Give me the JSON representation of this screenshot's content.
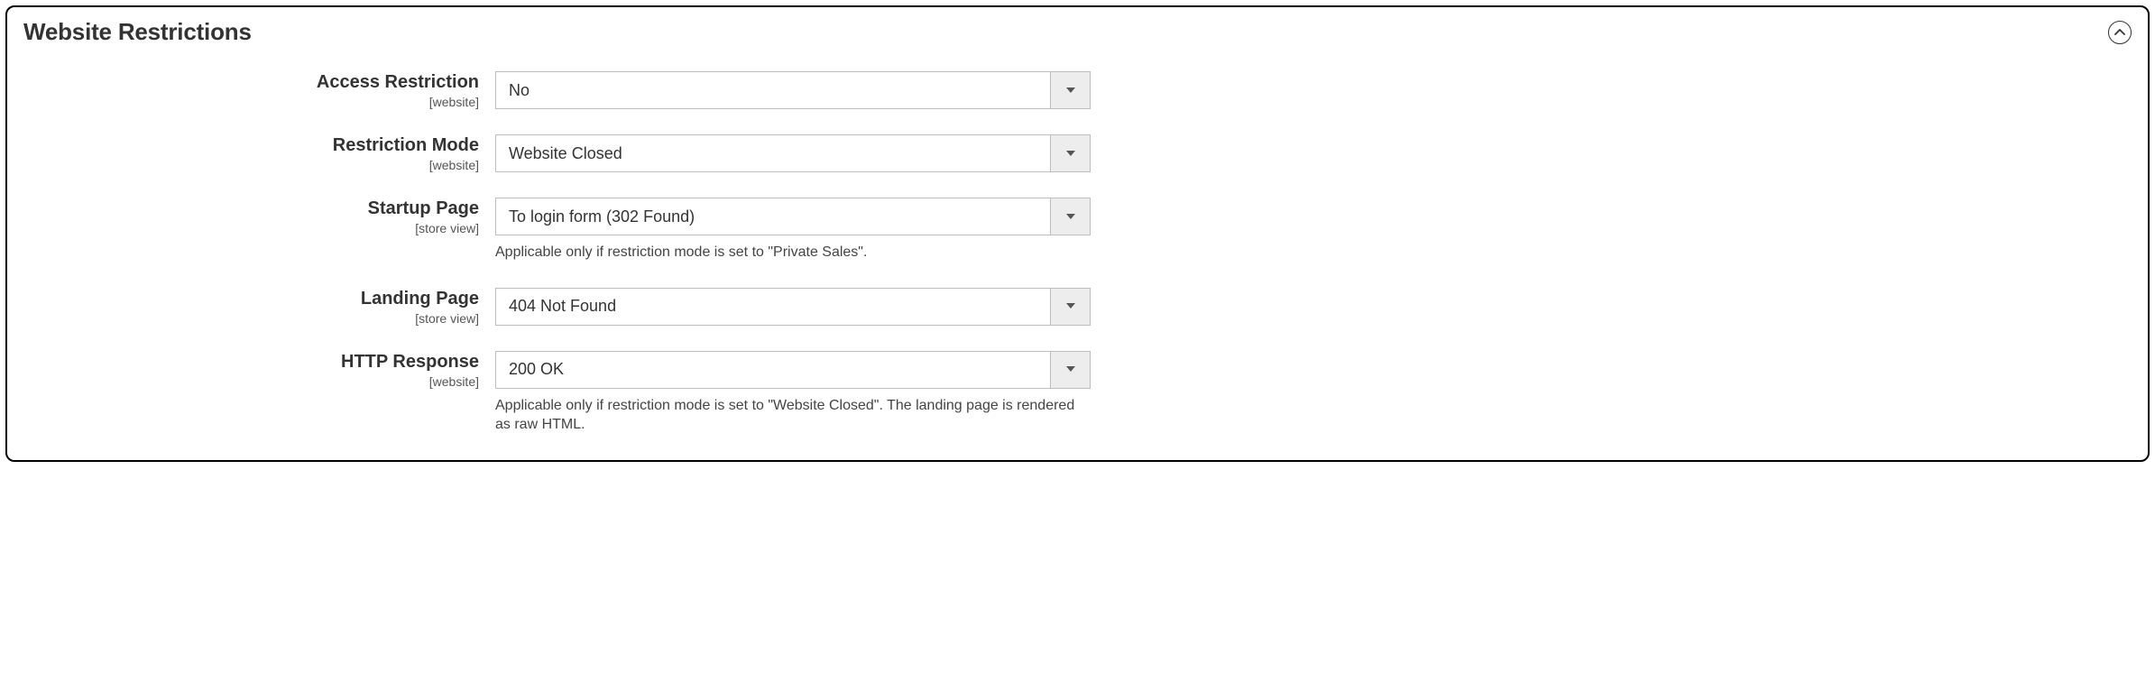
{
  "section": {
    "title": "Website Restrictions"
  },
  "fields": {
    "access_restriction": {
      "label": "Access Restriction",
      "scope": "[website]",
      "value": "No"
    },
    "restriction_mode": {
      "label": "Restriction Mode",
      "scope": "[website]",
      "value": "Website Closed"
    },
    "startup_page": {
      "label": "Startup Page",
      "scope": "[store view]",
      "value": "To login form (302 Found)",
      "help": "Applicable only if restriction mode is set to \"Private Sales\"."
    },
    "landing_page": {
      "label": "Landing Page",
      "scope": "[store view]",
      "value": "404 Not Found"
    },
    "http_response": {
      "label": "HTTP Response",
      "scope": "[website]",
      "value": "200 OK",
      "help": "Applicable only if restriction mode is set to \"Website Closed\". The landing page is rendered as raw HTML."
    }
  }
}
